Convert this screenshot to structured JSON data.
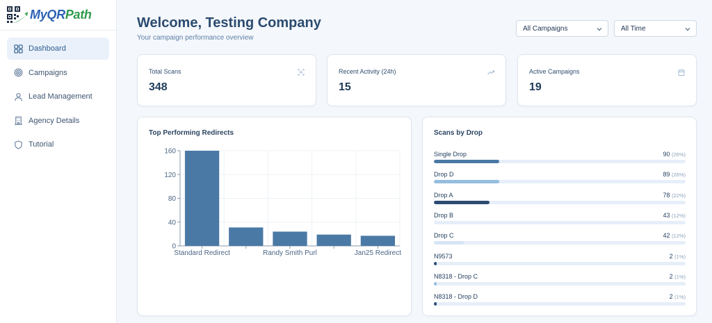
{
  "brand": {
    "name_part1": "MyQR",
    "name_part2": "Path"
  },
  "sidebar": {
    "items": [
      {
        "label": "Dashboard",
        "icon": "grid-icon",
        "active": true
      },
      {
        "label": "Campaigns",
        "icon": "target-icon",
        "active": false
      },
      {
        "label": "Lead Management",
        "icon": "user-icon",
        "active": false
      },
      {
        "label": "Agency Details",
        "icon": "building-icon",
        "active": false
      },
      {
        "label": "Tutorial",
        "icon": "shield-icon",
        "active": false
      }
    ]
  },
  "header": {
    "title": "Welcome, Testing Company",
    "subtitle": "Your campaign performance overview",
    "filters": {
      "campaign": "All Campaigns",
      "time": "All Time"
    }
  },
  "stats": [
    {
      "label": "Total Scans",
      "value": "348",
      "icon": "scan-icon"
    },
    {
      "label": "Recent Activity (24h)",
      "value": "15",
      "icon": "trending-up-icon"
    },
    {
      "label": "Active Campaigns",
      "value": "19",
      "icon": "calendar-icon"
    }
  ],
  "panels": {
    "redirects_title": "Top Performing Redirects",
    "drops_title": "Scans by Drop"
  },
  "chart_data": {
    "type": "bar",
    "categories": [
      "Standard Redirect",
      "",
      "Randy Smith Purl",
      "",
      "Jan25 Redirect"
    ],
    "values": [
      160,
      31,
      24,
      19,
      17
    ],
    "ylim": [
      0,
      160
    ],
    "yticks": [
      0,
      40,
      80,
      120,
      160
    ],
    "grid": true,
    "color": "#4a79a5"
  },
  "drops": [
    {
      "name": "Single Drop",
      "count": "90",
      "pct": "(26%)",
      "fraction": 0.26,
      "color": "#4a79a5"
    },
    {
      "name": "Drop D",
      "count": "89",
      "pct": "(26%)",
      "fraction": 0.26,
      "color": "#95bde0"
    },
    {
      "name": "Drop A",
      "count": "78",
      "pct": "(22%)",
      "fraction": 0.22,
      "color": "#2c4b71"
    },
    {
      "name": "Drop B",
      "count": "43",
      "pct": "(12%)",
      "fraction": 0.12,
      "color": "#e6eef9"
    },
    {
      "name": "Drop C",
      "count": "42",
      "pct": "(12%)",
      "fraction": 0.12,
      "color": "#d6e5f5"
    },
    {
      "name": "N9573",
      "count": "2",
      "pct": "(1%)",
      "fraction": 0.01,
      "color": "#2c4b71"
    },
    {
      "name": "N8318 - Drop C",
      "count": "2",
      "pct": "(1%)",
      "fraction": 0.01,
      "color": "#95bde0"
    },
    {
      "name": "N8318 - Drop D",
      "count": "2",
      "pct": "(1%)",
      "fraction": 0.01,
      "color": "#2c4b71"
    }
  ]
}
